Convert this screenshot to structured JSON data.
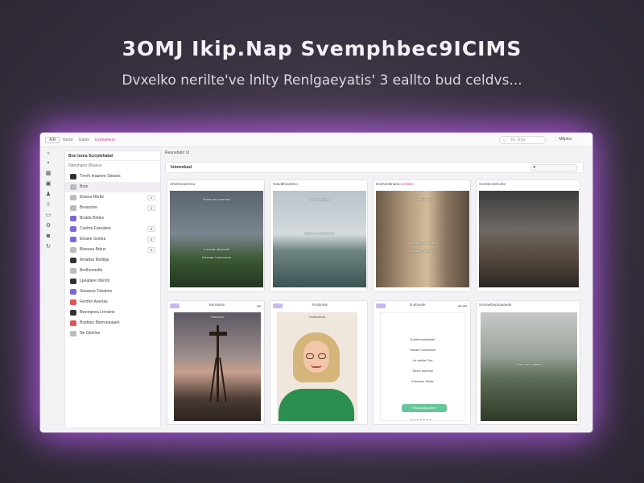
{
  "hero": {
    "title": "3OMJ Ikip.Nap Svemphbec9ICIMS",
    "subtitle": "Dvxelko nerilte've lnlty Renlgaeyatis' 3 eallto bud celdvs..."
  },
  "app": {
    "topbar": {
      "pill": "AIR",
      "tabs": [
        "Gend",
        "Gaels",
        "Evetvelerer"
      ],
      "search_placeholder": "Ri. GSa",
      "user": "Mtlptos"
    },
    "sidebar": {
      "header": "Bon Izena Scrrptehabel",
      "subheader": "Nbeohamr Bbaeve",
      "items": [
        {
          "label": "Trmrh Ieaamre Sleasts",
          "icon": "dark",
          "count": ""
        },
        {
          "label": "Bxre",
          "icon": "grey",
          "count": ""
        },
        {
          "label": "Eloees Rbrtle",
          "icon": "grey",
          "count": "1"
        },
        {
          "label": "Breaomre",
          "icon": "grey",
          "count": "2"
        },
        {
          "label": "Bratde Bntles",
          "icon": "purple",
          "count": ""
        },
        {
          "label": "Cuehre Fareatew",
          "icon": "purple",
          "count": "3"
        },
        {
          "label": "Eloaee Gretea",
          "icon": "purple",
          "count": "4"
        },
        {
          "label": "Bleeasa Brbus",
          "icon": "grey",
          "count": "5"
        },
        {
          "label": "Amattse Bebtiqe",
          "icon": "dark",
          "count": ""
        },
        {
          "label": "Bretheomdle",
          "icon": "grey",
          "count": ""
        },
        {
          "label": "Lpeataee Irlarvilr",
          "icon": "dark",
          "count": ""
        },
        {
          "label": "Seeanes Tobabne",
          "icon": "purple",
          "count": ""
        },
        {
          "label": "Ferrfter Aeertas",
          "icon": "red",
          "count": ""
        },
        {
          "label": "Bweeqeea Lrreame",
          "icon": "dark",
          "count": ""
        },
        {
          "label": "Bxpbtac Bierroeaaaeh",
          "icon": "red",
          "count": ""
        },
        {
          "label": "Ne Gtelrlee",
          "icon": "grey",
          "count": ""
        }
      ]
    },
    "main": {
      "breadcrumb": "Reonebolrr I2",
      "title": "Intomebasl",
      "cards": [
        {
          "caption": "Shtelenearrtrea",
          "accent": "",
          "overlay_top": "Sbertnoe eomrrtnel",
          "overlay_mid": "Lotmoar otlyaouel",
          "overlay_bottom": "Inlbeaar Leslvnmrns"
        },
        {
          "caption": "Gasdbhowlelvo",
          "accent": "",
          "overlay_top": "Sonxneebgbe",
          "overlay_mid": "Sammeraleebtelberer",
          "overlay_bottom": ""
        },
        {
          "caption": "Enehantbnaed",
          "accent": "Lereben",
          "overlay_top": "Fabdrnatbrb",
          "overlay_mid": "Aneeotboe leboarnel",
          "overlay_bottom": "Nleatrie Plrereder"
        },
        {
          "caption": "Suerttectretcobe",
          "accent": "",
          "overlay_top": "",
          "overlay_mid": "",
          "overlay_bottom": ""
        },
        {
          "caption": "Bsoratnle",
          "accent": "",
          "label": "Ntasctoo"
        },
        {
          "caption": "Rnolimde",
          "accent": "",
          "label": "Tsobeotede"
        },
        {
          "caption": "Ilnobuetle",
          "accent": "",
          "form_lines": [
            "Eoerthosuebbdel",
            "Hrawle nonorelnel",
            "Ltr nsltdel Tue",
            "Tieelh leoerele",
            "Entrsene 35nrtr"
          ],
          "button": "Stopnaatpowme"
        },
        {
          "caption": "Snmaelbepriaeaede",
          "accent": "",
          "overlay_mid": "Sbalrnoe Letteber"
        }
      ]
    }
  }
}
